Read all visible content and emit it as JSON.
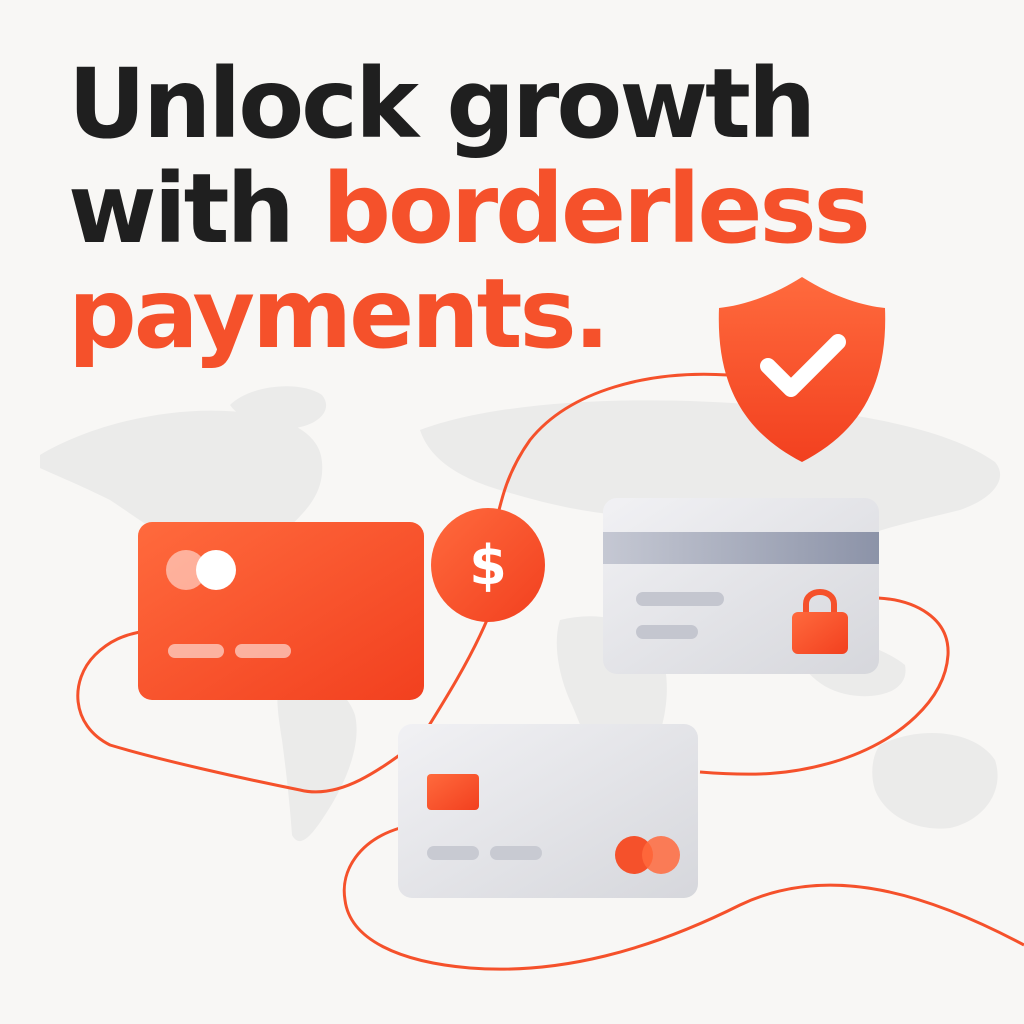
{
  "headline": {
    "line1": "Unlock growth",
    "line2_prefix": "with ",
    "line2_highlight": "borderless",
    "line3": "payments."
  },
  "colors": {
    "accent": "#f5512b",
    "text_dark": "#1f1f1f",
    "background": "#f8f7f5",
    "map": "#ebebea",
    "card_light": "#dcdde1",
    "card_stripe": "#9aa0b2"
  },
  "icons": {
    "shield": "shield-check-icon",
    "currency": "dollar-coin-icon",
    "lock": "padlock-icon",
    "brand": "card-brand-circles-icon",
    "chip": "card-chip-icon"
  }
}
